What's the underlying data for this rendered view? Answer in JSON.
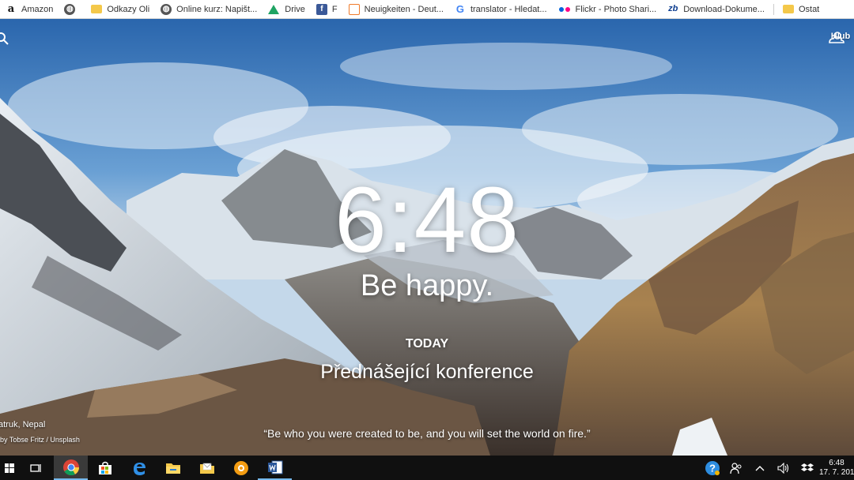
{
  "bookmarks": [
    {
      "icon": "amazon-icon",
      "label": "Amazon"
    },
    {
      "icon": "globe-icon",
      "label": ""
    },
    {
      "icon": "folder-icon",
      "label": "Odkazy Oli"
    },
    {
      "icon": "globe-icon",
      "label": "Online kurz: Napišt..."
    },
    {
      "icon": "drive-icon",
      "label": "Drive"
    },
    {
      "icon": "facebook-icon",
      "label": "F"
    },
    {
      "icon": "document-icon",
      "label": "Neuigkeiten - Deut..."
    },
    {
      "icon": "google-icon",
      "label": "translator - Hledat..."
    },
    {
      "icon": "flickr-icon",
      "label": "Flickr - Photo Shari..."
    },
    {
      "icon": "zb-icon",
      "label": "Download-Dokume..."
    },
    {
      "icon": "folder-icon",
      "label": "Ostat"
    }
  ],
  "weather": {
    "label": "Hlub"
  },
  "clock": {
    "time": "6:48"
  },
  "greeting": "Be happy.",
  "focus": {
    "label": "TODAY",
    "text": "Přednášející konference"
  },
  "quote": "“Be who you were created to be, and you will set the world on fire.”",
  "photo": {
    "location": "atruk, Nepal",
    "credit": "by Tobse Fritz / Unsplash"
  },
  "taskbar": {
    "apps": [
      {
        "name": "windows-start",
        "running": false
      },
      {
        "name": "task-view",
        "running": false
      },
      {
        "name": "chrome",
        "running": true,
        "active": true
      },
      {
        "name": "store",
        "running": false
      },
      {
        "name": "edge",
        "running": false
      },
      {
        "name": "file-explorer",
        "running": false
      },
      {
        "name": "mail-folder",
        "running": false
      },
      {
        "name": "orange-app",
        "running": false
      },
      {
        "name": "word",
        "running": true
      }
    ],
    "tray": {
      "time": "6:48",
      "date": "17. 7. 201"
    }
  },
  "colors": {
    "accent": "#76b9ed",
    "taskbar": "#101010",
    "sky": "#2f6fb7"
  }
}
